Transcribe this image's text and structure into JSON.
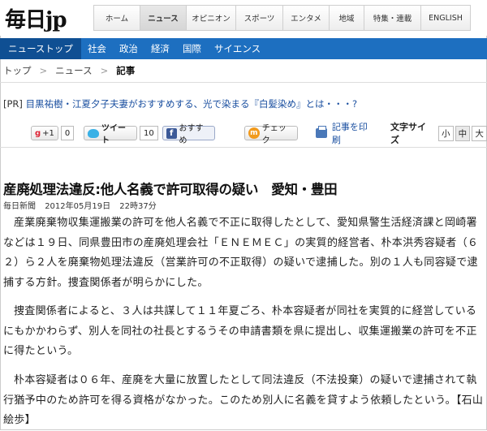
{
  "header": {
    "logo": "毎日jp",
    "nav": [
      "ホーム",
      "ニュース",
      "オピニオン",
      "スポーツ",
      "エンタメ",
      "地域",
      "特集・連載",
      "ENGLISH"
    ],
    "nav_active": 1
  },
  "subnav": [
    "ニューストップ",
    "社会",
    "政治",
    "経済",
    "国際",
    "サイエンス"
  ],
  "breadcrumb": [
    "トップ",
    "ニュース",
    "記事"
  ],
  "pr": {
    "tag": "[PR]",
    "text": "目黒祐樹・江夏夕子夫妻がおすすめする、光で染まる『白髪染め』とは・・・?"
  },
  "social": {
    "gplus": "+1",
    "gplus_count": "0",
    "tweet": "ツイート",
    "tweet_count": "10",
    "fb": "おすすめ",
    "check": "チェック",
    "print": "記事を印刷",
    "size_label": "文字サイズ",
    "sizes": [
      "小",
      "中",
      "大"
    ],
    "size_active": 1
  },
  "article": {
    "title": "産廃処理法違反:他人名義で許可取得の疑い　愛知・豊田",
    "source": "毎日新聞",
    "date": "2012年05月19日",
    "time": "22時37分",
    "paragraphs": [
      "産業廃棄物収集運搬業の許可を他人名義で不正に取得したとして、愛知県警生活経済課と岡崎署などは１９日、同県豊田市の産廃処理会社「ＥＮＥＭＥＣ」の実質的経営者、朴本洪秀容疑者（６２）ら２人を廃棄物処理法違反（営業許可の不正取得）の疑いで逮捕した。別の１人も同容疑で逮捕する方針。捜査関係者が明らかにした。",
      "捜査関係者によると、３人は共謀して１１年夏ごろ、朴本容疑者が同社を実質的に経営しているにもかかわらず、別人を同社の社長とするうその申請書類を県に提出し、収集運搬業の許可を不正に得たという。",
      "朴本容疑者は０６年、産廃を大量に放置したとして同法違反（不法投棄）の疑いで逮捕されて執行猶予中のため許可を得る資格がなかった。このため別人に名義を貸すよう依頼したという。【石山絵歩】"
    ]
  }
}
